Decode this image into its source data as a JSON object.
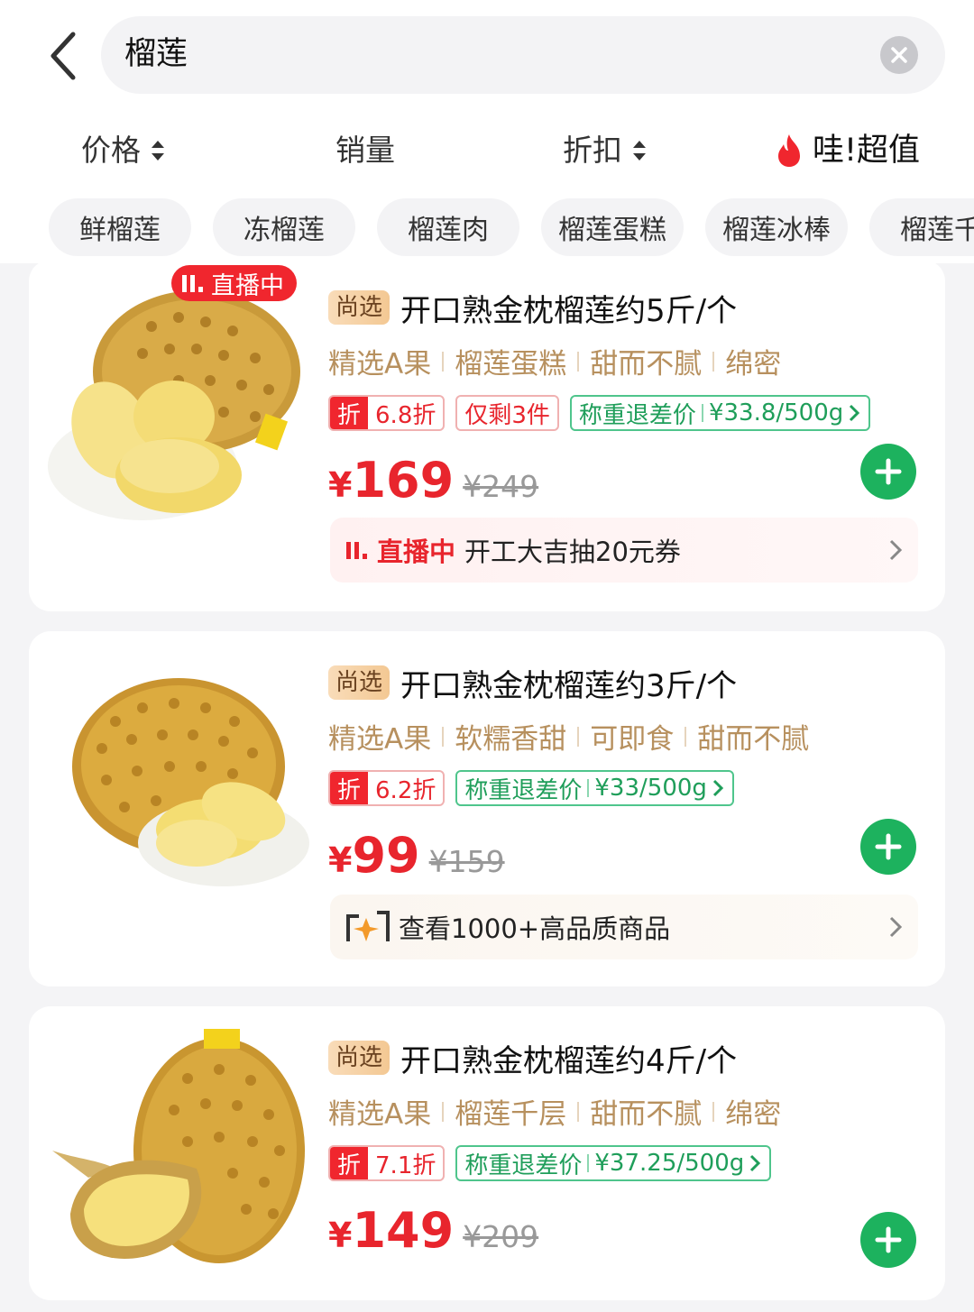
{
  "search": {
    "query": "榴莲"
  },
  "sort_bar": {
    "price": "价格",
    "sales": "销量",
    "discount": "折扣",
    "wow": "哇!超值"
  },
  "category_tags": [
    "鲜榴莲",
    "冻榴莲",
    "榴莲肉",
    "榴莲蛋糕",
    "榴莲冰棒",
    "榴莲千"
  ],
  "products": [
    {
      "live_badge": "直播中",
      "brand": "尚选",
      "title": "开口熟金枕榴莲约5斤/个",
      "features": [
        "精选A果",
        "榴莲蛋糕",
        "甜而不腻",
        "绵密"
      ],
      "discount_label": "折",
      "discount_value": "6.8折",
      "stock": "仅剩3件",
      "weigh_label": "称重退差价",
      "weigh_price": "¥33.8/500g",
      "currency": "¥",
      "price": "169",
      "old_price": "¥249",
      "promo_mark": "直播中",
      "promo_text": "开工大吉抽20元券"
    },
    {
      "brand": "尚选",
      "title": "开口熟金枕榴莲约3斤/个",
      "features": [
        "精选A果",
        "软糯香甜",
        "可即食",
        "甜而不腻"
      ],
      "discount_label": "折",
      "discount_value": "6.2折",
      "weigh_label": "称重退差价",
      "weigh_price": "¥33/500g",
      "currency": "¥",
      "price": "99",
      "old_price": "¥159",
      "promo_text": "查看1000+高品质商品"
    },
    {
      "brand": "尚选",
      "title": "开口熟金枕榴莲约4斤/个",
      "features": [
        "精选A果",
        "榴莲千层",
        "甜而不腻",
        "绵密"
      ],
      "discount_label": "折",
      "discount_value": "7.1折",
      "weigh_label": "称重退差价",
      "weigh_price": "¥37.25/500g",
      "currency": "¥",
      "price": "149",
      "old_price": "¥209"
    }
  ],
  "colors": {
    "accent_red": "#e8252d",
    "accent_green": "#1db25e",
    "feature_gold": "#b7905e"
  },
  "icons": [
    "back-arrow-icon",
    "clear-icon",
    "sort-arrows-icon",
    "flame-icon",
    "live-bars-icon",
    "plus-icon",
    "chevron-right-icon",
    "quality-logo-icon"
  ]
}
